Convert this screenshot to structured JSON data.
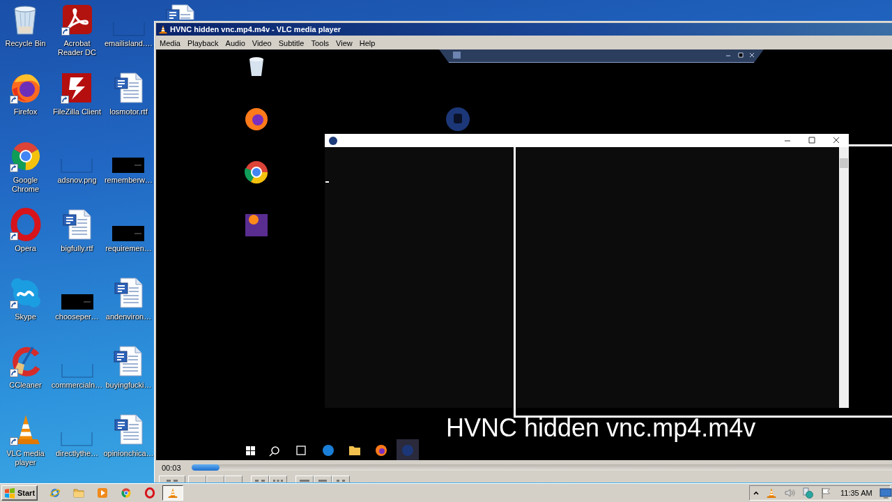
{
  "desktop": {
    "icons": [
      {
        "label": "Recycle Bin",
        "kind": "recycle-bin",
        "shortcut": false
      },
      {
        "label": "Firefox",
        "kind": "firefox",
        "shortcut": true
      },
      {
        "label": "Google Chrome",
        "kind": "chrome",
        "shortcut": true
      },
      {
        "label": "Opera",
        "kind": "opera",
        "shortcut": true
      },
      {
        "label": "Skype",
        "kind": "skype",
        "shortcut": true
      },
      {
        "label": "CCleaner",
        "kind": "ccleaner",
        "shortcut": true
      },
      {
        "label": "VLC media player",
        "kind": "vlc",
        "shortcut": true
      },
      {
        "label": "Acrobat Reader DC",
        "kind": "acrobat",
        "shortcut": true
      },
      {
        "label": "FileZilla Client",
        "kind": "filezilla",
        "shortcut": true
      },
      {
        "label": "adsnov.png",
        "kind": "blank-image",
        "shortcut": false
      },
      {
        "label": "bigfully.rtf",
        "kind": "word-doc",
        "shortcut": false
      },
      {
        "label": "chooseper…",
        "kind": "dark-image",
        "shortcut": false
      },
      {
        "label": "commercialn…",
        "kind": "blank-image",
        "shortcut": false
      },
      {
        "label": "directlythe…",
        "kind": "blank-image",
        "shortcut": false
      },
      {
        "label": "emailisland.…",
        "kind": "blank-image",
        "shortcut": false
      },
      {
        "label": "losmotor.rtf",
        "kind": "word-doc",
        "shortcut": false
      },
      {
        "label": "rememberw…",
        "kind": "dark-image",
        "shortcut": false
      },
      {
        "label": "requiremen…",
        "kind": "dark-image",
        "shortcut": false
      },
      {
        "label": "andenviron…",
        "kind": "word-doc",
        "shortcut": false
      },
      {
        "label": "buyingfucki…",
        "kind": "word-doc",
        "shortcut": false
      },
      {
        "label": "opinionchica…",
        "kind": "word-doc",
        "shortcut": false
      },
      {
        "kind": "word-doc",
        "shortcut": false
      }
    ]
  },
  "vlc_window": {
    "title": "HVNC hidden vnc.mp4.m4v - VLC media player",
    "menu": [
      "Media",
      "Playback",
      "Audio",
      "Video",
      "Subtitle",
      "Tools",
      "View",
      "Help"
    ],
    "osd_title": "HVNC hidden vnc.mp4.m4v",
    "elapsed": "00:03",
    "seek": {
      "level": 0.04
    },
    "control_groups": [
      [
        {
          "kind": "pause"
        }
      ],
      [
        {
          "kind": "previous"
        },
        {
          "kind": "stop"
        },
        {
          "kind": "next"
        }
      ],
      [
        {
          "kind": "fullscreen"
        },
        {
          "kind": "extended"
        }
      ],
      [
        {
          "kind": "playlist"
        },
        {
          "kind": "loop"
        },
        {
          "kind": "random"
        }
      ]
    ]
  },
  "taskbar": {
    "start": "Start",
    "quick_launch": [
      {
        "kind": "ie"
      },
      {
        "kind": "explorer"
      },
      {
        "kind": "media-player"
      },
      {
        "kind": "chrome"
      },
      {
        "kind": "opera"
      }
    ],
    "tasks": [
      {
        "kind": "vlc",
        "selected": true
      }
    ],
    "tray": {
      "icons": [
        {
          "kind": "chevron"
        },
        {
          "kind": "vlc"
        },
        {
          "kind": "speaker"
        },
        {
          "kind": "network"
        },
        {
          "kind": "flag"
        }
      ],
      "clock": "11:35 AM"
    }
  }
}
